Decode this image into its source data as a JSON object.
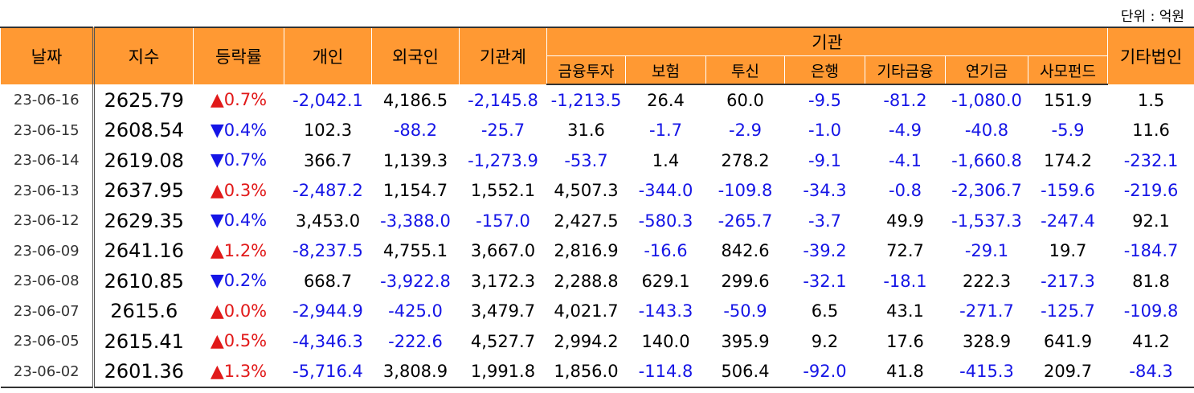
{
  "unit_label": "단위 : 억원",
  "headers": {
    "date": "날짜",
    "index": "지수",
    "change": "등락률",
    "individual": "개인",
    "foreign": "외국인",
    "inst_total": "기관계",
    "inst_group": "기관",
    "inst_sub": [
      "금융투자",
      "보험",
      "투신",
      "은행",
      "기타금융",
      "연기금",
      "사모펀드"
    ],
    "other_corp": "기타법인"
  },
  "colors": {
    "header_bg": "#ff9933",
    "negative": "#1515e6",
    "up_arrow": "#e11919",
    "down_arrow": "#1515e6"
  },
  "rows": [
    {
      "date": "23-06-16",
      "index": "2625.79",
      "arrow": "▲",
      "dir": "up",
      "rate": "0.7%",
      "cells": [
        "-2,042.1",
        "4,186.5",
        "-2,145.8",
        "-1,213.5",
        "26.4",
        "60.0",
        "-9.5",
        "-81.2",
        "-1,080.0",
        "151.9",
        "1.5"
      ]
    },
    {
      "date": "23-06-15",
      "index": "2608.54",
      "arrow": "▼",
      "dir": "dn",
      "rate": "0.4%",
      "cells": [
        "102.3",
        "-88.2",
        "-25.7",
        "31.6",
        "-1.7",
        "-2.9",
        "-1.0",
        "-4.9",
        "-40.8",
        "-5.9",
        "11.6"
      ]
    },
    {
      "date": "23-06-14",
      "index": "2619.08",
      "arrow": "▼",
      "dir": "dn",
      "rate": "0.7%",
      "cells": [
        "366.7",
        "1,139.3",
        "-1,273.9",
        "-53.7",
        "1.4",
        "278.2",
        "-9.1",
        "-4.1",
        "-1,660.8",
        "174.2",
        "-232.1"
      ]
    },
    {
      "date": "23-06-13",
      "index": "2637.95",
      "arrow": "▲",
      "dir": "up",
      "rate": "0.3%",
      "cells": [
        "-2,487.2",
        "1,154.7",
        "1,552.1",
        "4,507.3",
        "-344.0",
        "-109.8",
        "-34.3",
        "-0.8",
        "-2,306.7",
        "-159.6",
        "-219.6"
      ]
    },
    {
      "date": "23-06-12",
      "index": "2629.35",
      "arrow": "▼",
      "dir": "dn",
      "rate": "0.4%",
      "cells": [
        "3,453.0",
        "-3,388.0",
        "-157.0",
        "2,427.5",
        "-580.3",
        "-265.7",
        "-3.7",
        "49.9",
        "-1,537.3",
        "-247.4",
        "92.1"
      ]
    },
    {
      "date": "23-06-09",
      "index": "2641.16",
      "arrow": "▲",
      "dir": "up",
      "rate": "1.2%",
      "cells": [
        "-8,237.5",
        "4,755.1",
        "3,667.0",
        "2,816.9",
        "-16.6",
        "842.6",
        "-39.2",
        "72.7",
        "-29.1",
        "19.7",
        "-184.7"
      ]
    },
    {
      "date": "23-06-08",
      "index": "2610.85",
      "arrow": "▼",
      "dir": "dn",
      "rate": "0.2%",
      "cells": [
        "668.7",
        "-3,922.8",
        "3,172.3",
        "2,288.8",
        "629.1",
        "299.6",
        "-32.1",
        "-18.1",
        "222.3",
        "-217.3",
        "81.8"
      ]
    },
    {
      "date": "23-06-07",
      "index": "2615.6",
      "arrow": "▲",
      "dir": "up",
      "rate": "0.0%",
      "cells": [
        "-2,944.9",
        "-425.0",
        "3,479.7",
        "4,021.7",
        "-143.3",
        "-50.9",
        "6.5",
        "43.1",
        "-271.7",
        "-125.7",
        "-109.8"
      ]
    },
    {
      "date": "23-06-05",
      "index": "2615.41",
      "arrow": "▲",
      "dir": "up",
      "rate": "0.5%",
      "cells": [
        "-4,346.3",
        "-222.6",
        "4,527.7",
        "2,994.2",
        "140.0",
        "395.9",
        "9.2",
        "17.6",
        "328.9",
        "641.9",
        "41.2"
      ]
    },
    {
      "date": "23-06-02",
      "index": "2601.36",
      "arrow": "▲",
      "dir": "up",
      "rate": "1.3%",
      "cells": [
        "-5,716.4",
        "3,808.9",
        "1,991.8",
        "1,856.0",
        "-114.8",
        "506.4",
        "-92.0",
        "41.8",
        "-415.3",
        "209.7",
        "-84.3"
      ]
    }
  ]
}
